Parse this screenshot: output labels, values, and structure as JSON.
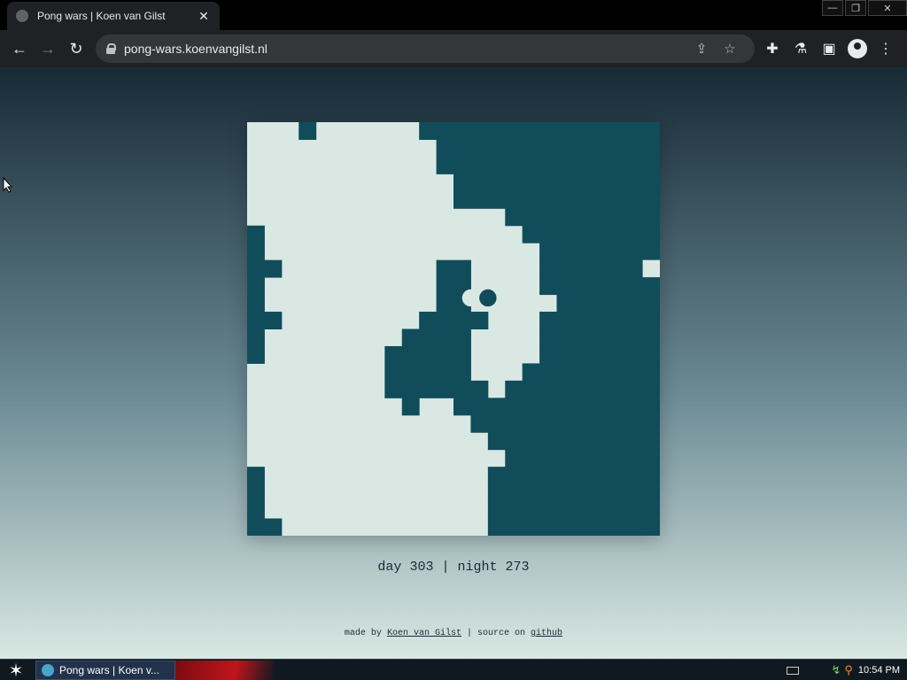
{
  "browser": {
    "tab_title": "Pong wars | Koen van Gilst",
    "tab_close": "✕",
    "url": "pong-wars.koenvangilst.nl",
    "window_buttons": {
      "minimize": "—",
      "restore": "❐",
      "close": "✕"
    }
  },
  "game": {
    "grid_cols": 24,
    "grid_rows": 24,
    "colors": {
      "day": "#d9e8e3",
      "night": "#114c5a"
    },
    "night_runs": [
      [
        [
          3,
          3
        ],
        [
          10,
          23
        ]
      ],
      [
        [
          11,
          23
        ]
      ],
      [
        [
          11,
          23
        ]
      ],
      [
        [
          12,
          23
        ]
      ],
      [
        [
          12,
          23
        ]
      ],
      [
        [
          15,
          23
        ]
      ],
      [
        [
          0,
          0
        ],
        [
          16,
          23
        ]
      ],
      [
        [
          0,
          0
        ],
        [
          17,
          23
        ]
      ],
      [
        [
          0,
          1
        ],
        [
          11,
          12
        ],
        [
          17,
          23
        ]
      ],
      [
        [
          0,
          0
        ],
        [
          11,
          12
        ],
        [
          17,
          23
        ]
      ],
      [
        [
          0,
          0
        ],
        [
          11,
          12
        ],
        [
          18,
          23
        ]
      ],
      [
        [
          0,
          1
        ],
        [
          10,
          13
        ],
        [
          17,
          23
        ]
      ],
      [
        [
          0,
          0
        ],
        [
          9,
          12
        ],
        [
          17,
          23
        ]
      ],
      [
        [
          0,
          0
        ],
        [
          8,
          12
        ],
        [
          17,
          23
        ]
      ],
      [
        [
          8,
          12
        ],
        [
          16,
          23
        ]
      ],
      [
        [
          8,
          13
        ],
        [
          15,
          23
        ]
      ],
      [
        [
          9,
          9
        ],
        [
          12,
          23
        ]
      ],
      [
        [
          13,
          23
        ]
      ],
      [
        [
          14,
          23
        ]
      ],
      [
        [
          15,
          23
        ]
      ],
      [
        [
          0,
          0
        ],
        [
          14,
          23
        ]
      ],
      [
        [
          0,
          0
        ],
        [
          14,
          23
        ]
      ],
      [
        [
          0,
          0
        ],
        [
          14,
          23
        ]
      ],
      [
        [
          0,
          1
        ],
        [
          14,
          23
        ]
      ]
    ],
    "day_cells": [
      [
        8,
        23
      ]
    ],
    "balls": [
      {
        "col": 12.5,
        "row": 9.7,
        "side": "day"
      },
      {
        "col": 13.5,
        "row": 9.7,
        "side": "night"
      }
    ]
  },
  "score": {
    "day_label": "day",
    "day_value": "303",
    "separator": "|",
    "night_label": "night",
    "night_value": "273"
  },
  "footer": {
    "made_by": "made by",
    "author": "Koen van Gilst",
    "sep": "|",
    "source_on": "source on",
    "github": "github"
  },
  "taskbar": {
    "task_title": "Pong wars | Koen v...",
    "clock": "10:54 PM"
  }
}
